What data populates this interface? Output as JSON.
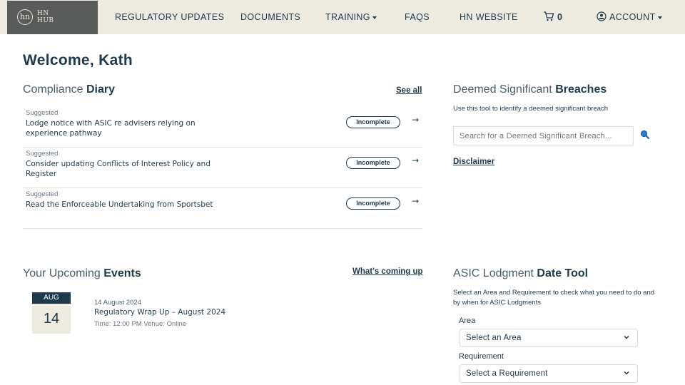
{
  "nav": {
    "logo_mark": "hn",
    "logo_line1": "HN",
    "logo_line2": "HUB",
    "items": [
      "REGULATORY UPDATES",
      "DOCUMENTS",
      "TRAINING",
      "FAQS",
      "HN WEBSITE"
    ],
    "cart_count": "0",
    "account": "ACCOUNT"
  },
  "welcome": "Welcome, Kath",
  "diary": {
    "title_light": "Compliance ",
    "title_bold": "Diary",
    "see_all": "See all",
    "rows": [
      {
        "tag": "Suggested",
        "title": "Lodge notice with ASIC re advisers relying on experience pathway",
        "status": "Incomplete",
        "arrow": "→"
      },
      {
        "tag": "Suggested",
        "title": "Consider updating Conflicts of Interest Policy and Register",
        "status": "Incomplete",
        "arrow": "→"
      },
      {
        "tag": "Suggested",
        "title": "Read the Enforceable Undertaking from Sportsbet",
        "status": "Incomplete",
        "arrow": "→"
      }
    ]
  },
  "breaches": {
    "title_light": "Deemed Significant ",
    "title_bold": "Breaches",
    "desc": "Use this tool to identify a deemed significant breach",
    "search_placeholder": "Search for a Deemed Significant Breach...",
    "disclaimer": "Disclaimer"
  },
  "events": {
    "title_light": "Your Upcoming ",
    "title_bold": "Events",
    "whats_coming": "What's coming up",
    "items": [
      {
        "month": "AUG",
        "day": "14",
        "date": "14 August 2024",
        "title": "Regulatory Wrap Up – August 2024",
        "meta": "Time: 12:00 PM Venue: Online"
      }
    ]
  },
  "asic": {
    "title_light": "ASIC Lodgment ",
    "title_bold": "Date Tool",
    "desc": "Select an Area and Requirement to check what you need to do and by when for ASIC Lodgments",
    "area_label": "Area",
    "area_value": "Select an Area",
    "req_label": "Requirement",
    "req_value": "Select a Requirement"
  },
  "colors": {
    "nav_bg": "#edeae0",
    "logo_bg": "#5a5c5c",
    "text_primary": "#1e3a4c",
    "search_icon": "#2a7fd4"
  }
}
